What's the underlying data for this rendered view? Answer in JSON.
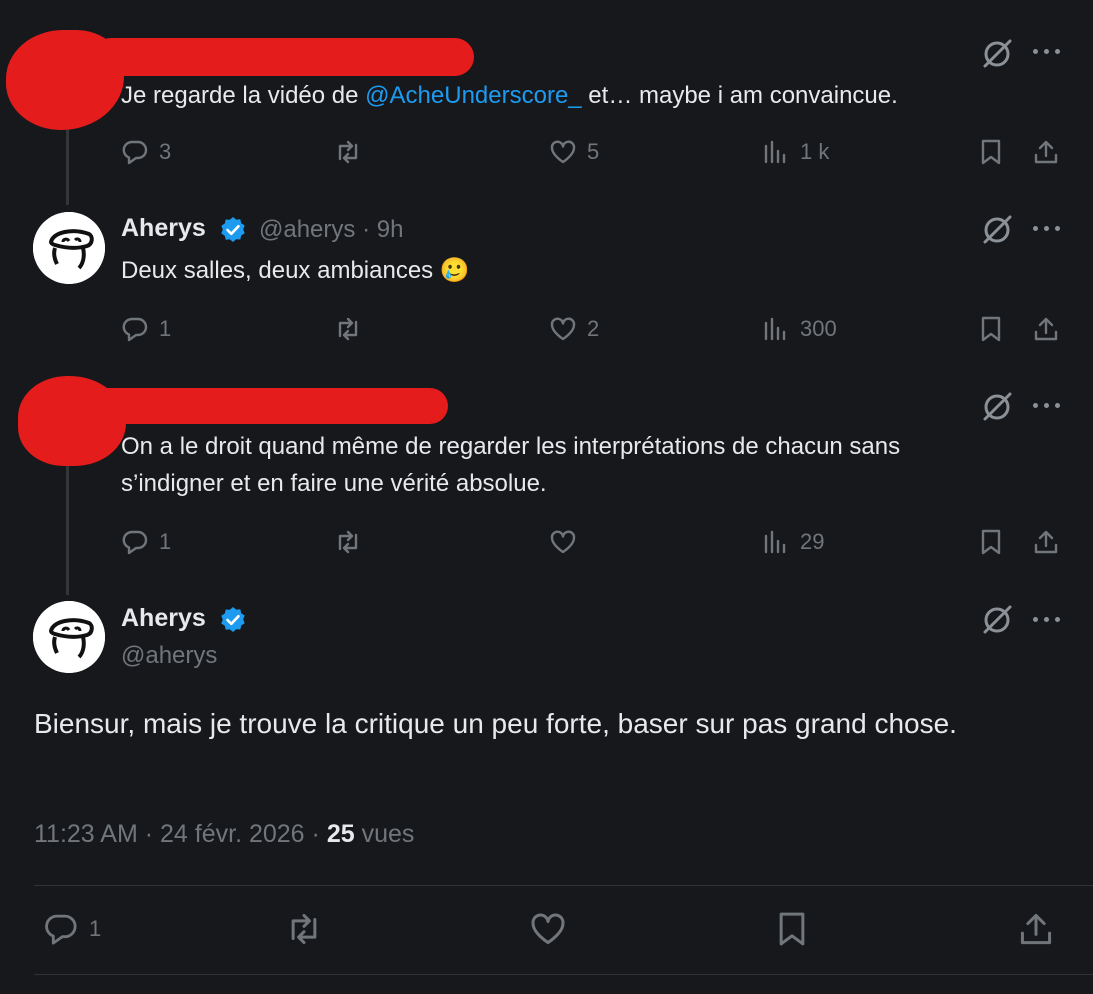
{
  "colors": {
    "background": "#16181c",
    "text": "#e7e9ea",
    "muted": "#71767b",
    "link": "#1d9bf0",
    "verified": "#1d9bf0",
    "redaction": "#e41c1c"
  },
  "tweets": [
    {
      "redacted_author": true,
      "text_before": "Je regarde la vidéo de ",
      "mention": "@AcheUnderscore_",
      "text_after": " et… maybe i am convaincue.",
      "replies": "3",
      "reposts": "",
      "likes": "5",
      "views": "1 k"
    },
    {
      "name": "Aherys",
      "handle_time": "@aherys · 9h",
      "text": "Deux salles, deux ambiances 🥲",
      "replies": "1",
      "reposts": "",
      "likes": "2",
      "views": "300"
    },
    {
      "redacted_author": true,
      "text_line1": "On a le droit quand même de regarder les interprétations de chacun sans",
      "text_line2": "s’indigner et en faire une vérité absolue.",
      "replies": "1",
      "reposts": "",
      "likes": "",
      "views": "29"
    }
  ],
  "main_tweet": {
    "name": "Aherys",
    "handle": "@aherys",
    "text": "Biensur, mais je trouve la critique un peu forte, baser sur pas grand chose.",
    "time": "11:23 AM",
    "sep": "·",
    "date": "24 févr. 2026",
    "views_count": "25",
    "views_label": "vues",
    "replies": "1"
  },
  "icons": {
    "reply": "reply-icon",
    "repost": "repost-icon",
    "like": "heart-icon",
    "views": "views-chart-icon",
    "bookmark": "bookmark-icon",
    "share": "share-icon",
    "grok": "grok-icon",
    "more": "more-icon",
    "verified": "verified-badge-icon"
  }
}
